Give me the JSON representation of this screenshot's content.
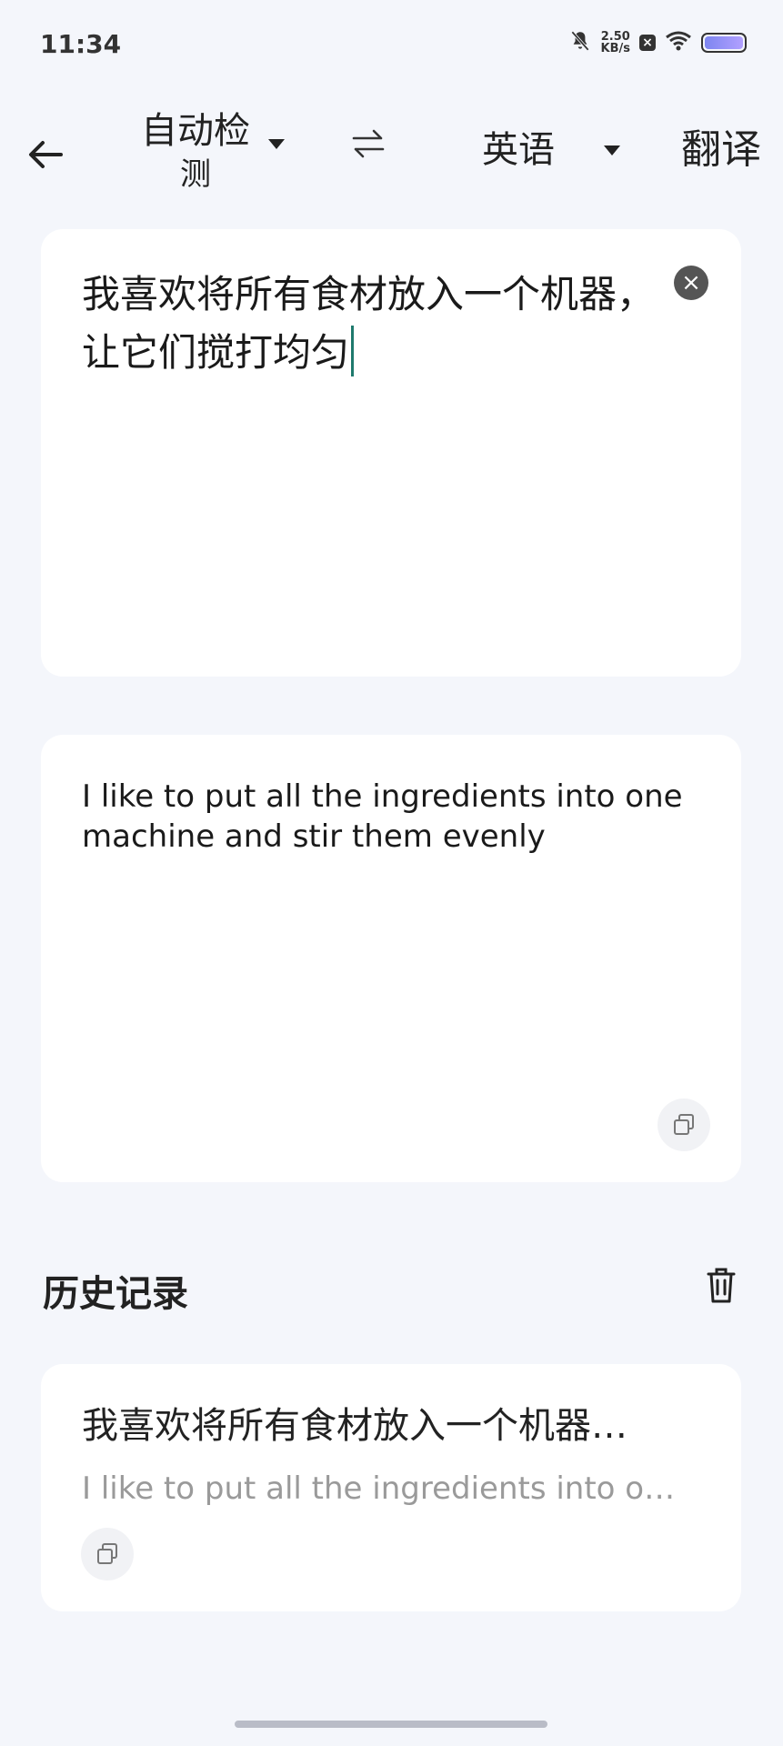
{
  "status_bar": {
    "time": "11:34",
    "net_speed_value": "2.50",
    "net_speed_unit": "KB/s"
  },
  "toolbar": {
    "source_language_line1": "自动检",
    "source_language_line2": "测",
    "target_language": "英语",
    "translate_label": "翻译"
  },
  "input": {
    "text": "我喜欢将所有食材放入一个机器，让它们搅打均匀"
  },
  "output": {
    "text": "I like to put all the ingredients into one machine and stir them evenly"
  },
  "history": {
    "title": "历史记录",
    "items": [
      {
        "source": "我喜欢将所有食材放入一个机器…",
        "translation": "I like to put all the ingredients into o…"
      }
    ]
  },
  "colors": {
    "background": "#f4f6fb",
    "card": "#ffffff",
    "cursor": "#1f7a6d",
    "secondary_text": "#9a9a9a"
  },
  "icons": [
    "back-arrow-icon",
    "dropdown-caret-icon",
    "swap-icon",
    "clear-icon",
    "copy-icon",
    "trash-icon",
    "mute-bell-icon",
    "wifi-icon",
    "battery-icon"
  ]
}
